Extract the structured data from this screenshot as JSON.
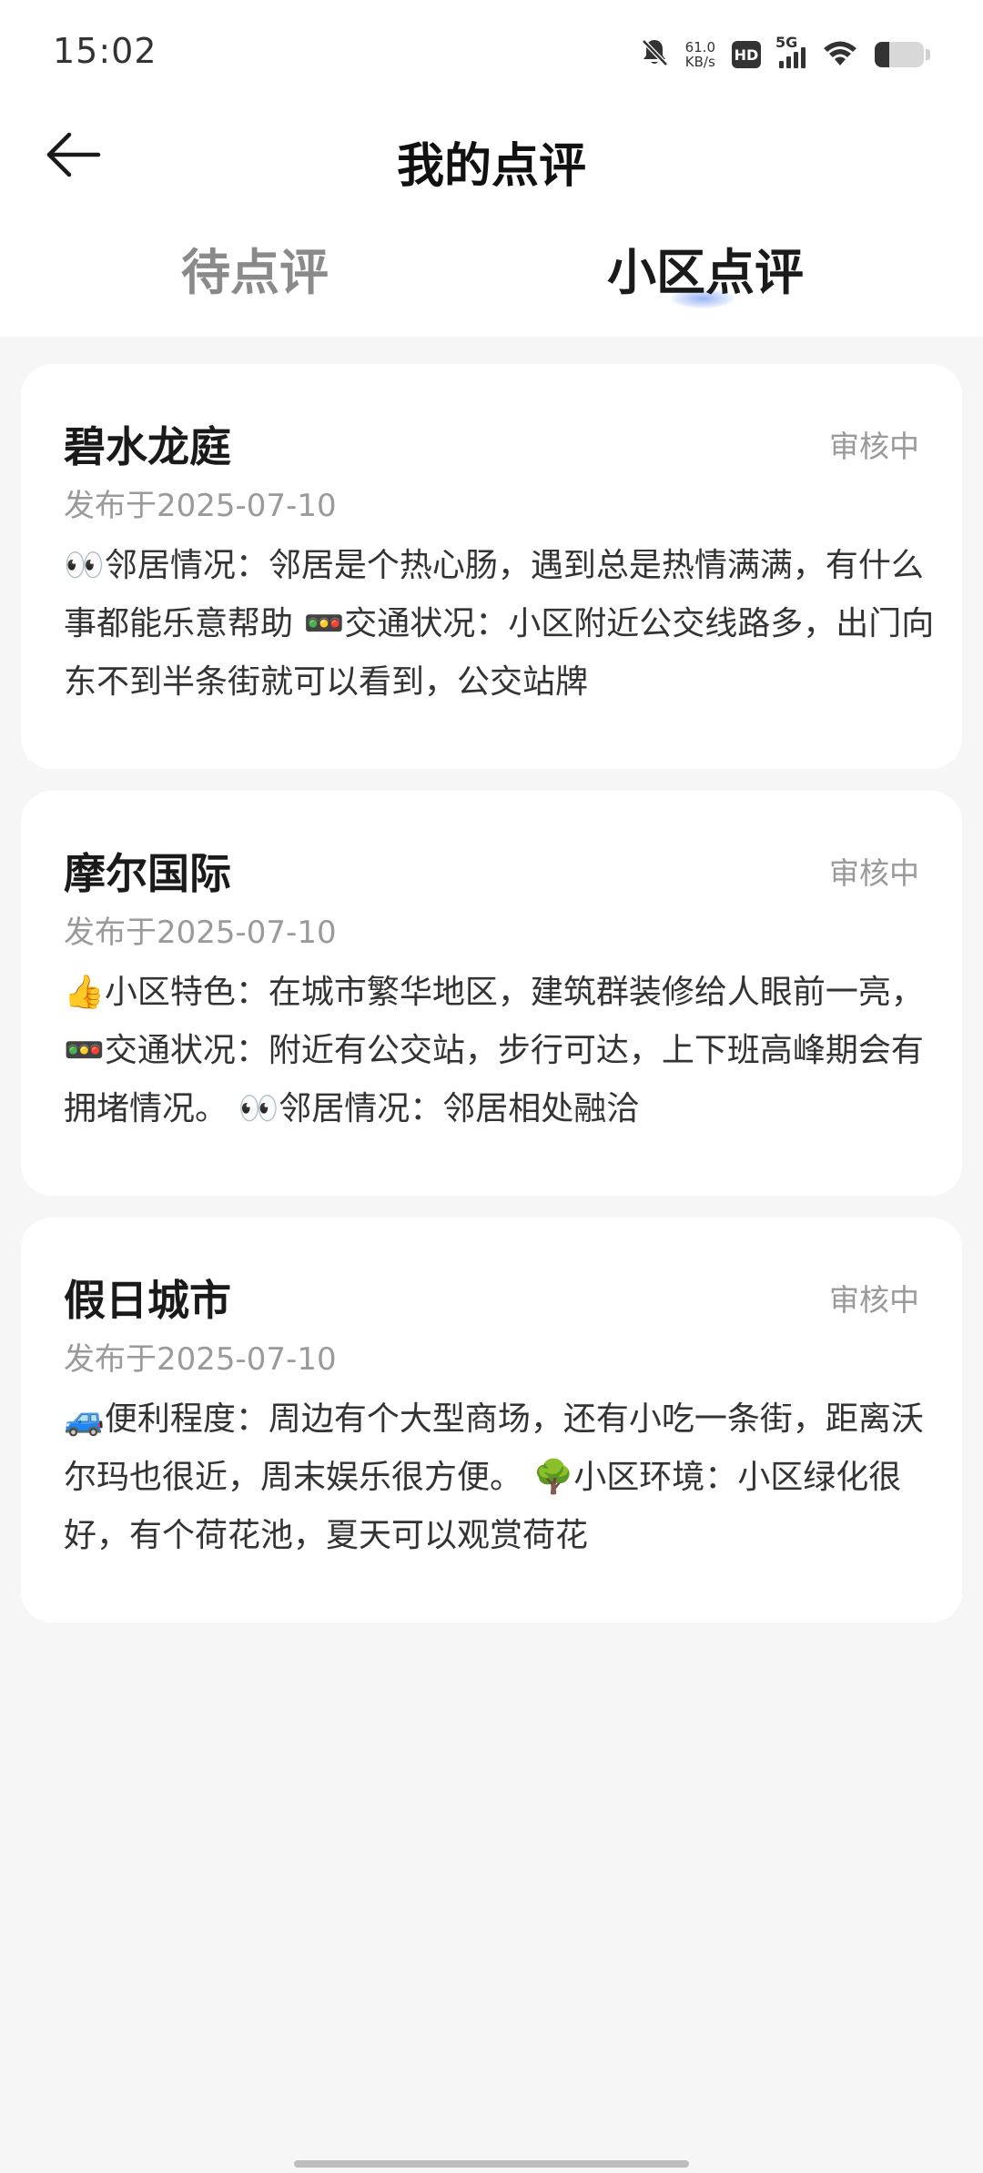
{
  "status_bar": {
    "time": "15:02",
    "net_speed_value": "61.0",
    "net_speed_unit": "KB/s",
    "hd_label": "HD",
    "signal_label": "5G"
  },
  "header": {
    "title": "我的点评"
  },
  "tabs": [
    {
      "label": "待点评",
      "active": false
    },
    {
      "label": "小区点评",
      "active": true
    }
  ],
  "reviews": [
    {
      "title": "碧水龙庭",
      "status": "审核中",
      "date": "发布于2025-07-10",
      "content": "👀邻居情况：邻居是个热心肠，遇到总是热情满满，有什么事都能乐意帮助 🚥交通状况：小区附近公交线路多，出门向东不到半条街就可以看到，公交站牌"
    },
    {
      "title": "摩尔国际",
      "status": "审核中",
      "date": "发布于2025-07-10",
      "content": "👍小区特色：在城市繁华地区，建筑群装修给人眼前一亮， 🚥交通状况：附近有公交站，步行可达，上下班高峰期会有拥堵情况。 👀邻居情况：邻居相处融洽"
    },
    {
      "title": "假日城市",
      "status": "审核中",
      "date": "发布于2025-07-10",
      "content": "🚙便利程度：周边有个大型商场，还有小吃一条街，距离沃尔玛也很近，周末娱乐很方便。 🌳小区环境：小区绿化很好，有个荷花池，夏天可以观赏荷花"
    }
  ],
  "colors": {
    "accent": "#4678f0",
    "status_text": "#9a9a9a",
    "page_bg": "#f6f6f6"
  }
}
